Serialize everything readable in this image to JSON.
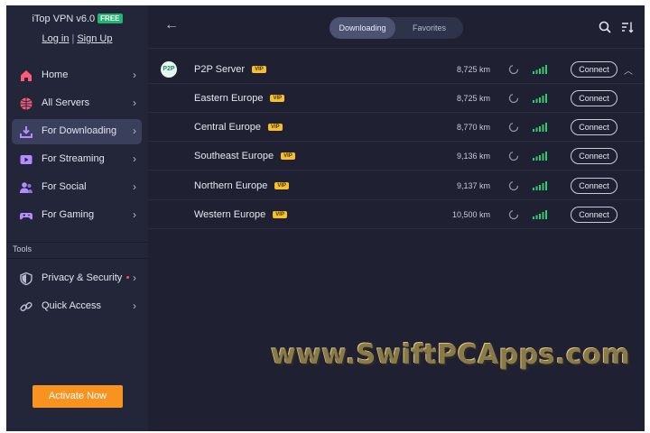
{
  "app": {
    "title": "iTop VPN v6.0",
    "badge": "FREE"
  },
  "auth": {
    "login": "Log in",
    "separator": "|",
    "signup": "Sign Up"
  },
  "sidebar": {
    "items": [
      {
        "label": "Home",
        "icon": "home-icon"
      },
      {
        "label": "All Servers",
        "icon": "globe-icon"
      },
      {
        "label": "For Downloading",
        "icon": "download-icon",
        "active": true
      },
      {
        "label": "For Streaming",
        "icon": "play-icon"
      },
      {
        "label": "For Social",
        "icon": "users-icon"
      },
      {
        "label": "For Gaming",
        "icon": "gamepad-icon"
      }
    ],
    "tools_label": "Tools",
    "tools": [
      {
        "label": "Privacy & Security",
        "icon": "shield-icon",
        "dot": true
      },
      {
        "label": "Quick Access",
        "icon": "link-icon"
      }
    ],
    "activate_label": "Activate Now"
  },
  "header": {
    "tabs": [
      {
        "label": "Downloading",
        "active": true
      },
      {
        "label": "Favorites"
      }
    ]
  },
  "servers": [
    {
      "name": "P2P Server",
      "vip": "VIP",
      "distance": "8,725 km",
      "connect": "Connect",
      "group": true,
      "logo": "P2P"
    },
    {
      "name": "Eastern Europe",
      "vip": "VIP",
      "distance": "8,725 km",
      "connect": "Connect"
    },
    {
      "name": "Central Europe",
      "vip": "VIP",
      "distance": "8,770 km",
      "connect": "Connect"
    },
    {
      "name": "Southeast Europe",
      "vip": "VIP",
      "distance": "9,136 km",
      "connect": "Connect"
    },
    {
      "name": "Northern Europe",
      "vip": "VIP",
      "distance": "9,137 km",
      "connect": "Connect"
    },
    {
      "name": "Western Europe",
      "vip": "VIP",
      "distance": "10,500 km",
      "connect": "Connect"
    }
  ],
  "watermark": "www.SwiftPCApps.com",
  "colors": {
    "accent_orange": "#f7931e",
    "free_green": "#22b572",
    "vip_yellow": "#f5c02a",
    "signal_green": "#2ecc71",
    "sidebar_bg": "#232638",
    "main_bg": "#1f2132"
  }
}
